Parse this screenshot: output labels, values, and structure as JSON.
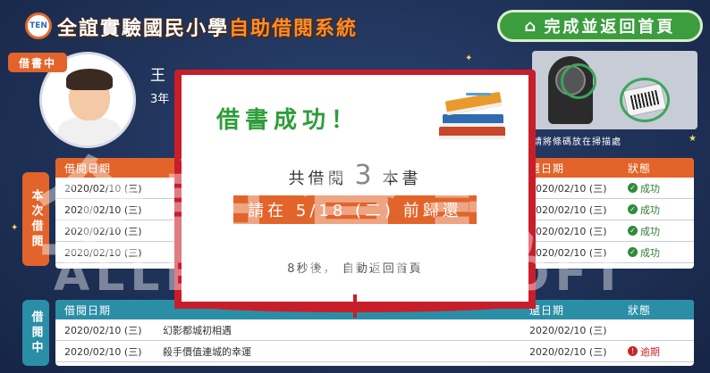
{
  "header": {
    "logo_text": "TEN",
    "title_part1": "全誼實驗國民小學",
    "title_part2": "自助借閱系統",
    "finish_button": "完成並返回首頁"
  },
  "user": {
    "status_tag": "借書中",
    "name": "王",
    "class": "3年"
  },
  "scanner": {
    "hint": "請將條碼放在掃描處"
  },
  "borrowed": {
    "side_label": "本次借閱",
    "headers": {
      "date": "借閱日期",
      "title": "",
      "due": "還日期",
      "status": "狀態"
    },
    "rows": [
      {
        "date": "2020/02/10 (三)",
        "title": "",
        "due": "2020/02/10 (三)",
        "status": "成功"
      },
      {
        "date": "2020/02/10 (三)",
        "title": "",
        "due": "2020/02/10 (三)",
        "status": "成功"
      },
      {
        "date": "2020/02/10 (三)",
        "title": "",
        "due": "2020/02/10 (三)",
        "status": "成功"
      },
      {
        "date": "2020/02/10 (三)",
        "title": "",
        "due": "2020/02/10 (三)",
        "status": "成功"
      }
    ]
  },
  "on_loan": {
    "side_label": "借閱中",
    "headers": {
      "date": "借閱日期",
      "title": "",
      "due": "還日期",
      "status": "狀態"
    },
    "rows": [
      {
        "date": "2020/02/10 (三)",
        "title": "幻影都城初相遇",
        "due": "2020/02/10 (三)",
        "status": ""
      },
      {
        "date": "2020/02/10 (三)",
        "title": "殺手價值連城的幸運",
        "due": "2020/02/10 (三)",
        "status": "逾期"
      }
    ]
  },
  "modal": {
    "title": "借書成功！",
    "count_prefix": "共借閱",
    "count": "3",
    "count_suffix": "本書",
    "due_notice": "請在 5/18 (二) 前歸還",
    "auto_return": "8秒後， 自動返回首頁"
  },
  "watermark": {
    "chinese": "全誼資訊",
    "english": "ALLE SCHOOLSOFT"
  },
  "colors": {
    "accent_orange": "#e2642a",
    "accent_teal": "#2a8ea6",
    "success_green": "#2f9d3a",
    "modal_red": "#c81e2a"
  }
}
